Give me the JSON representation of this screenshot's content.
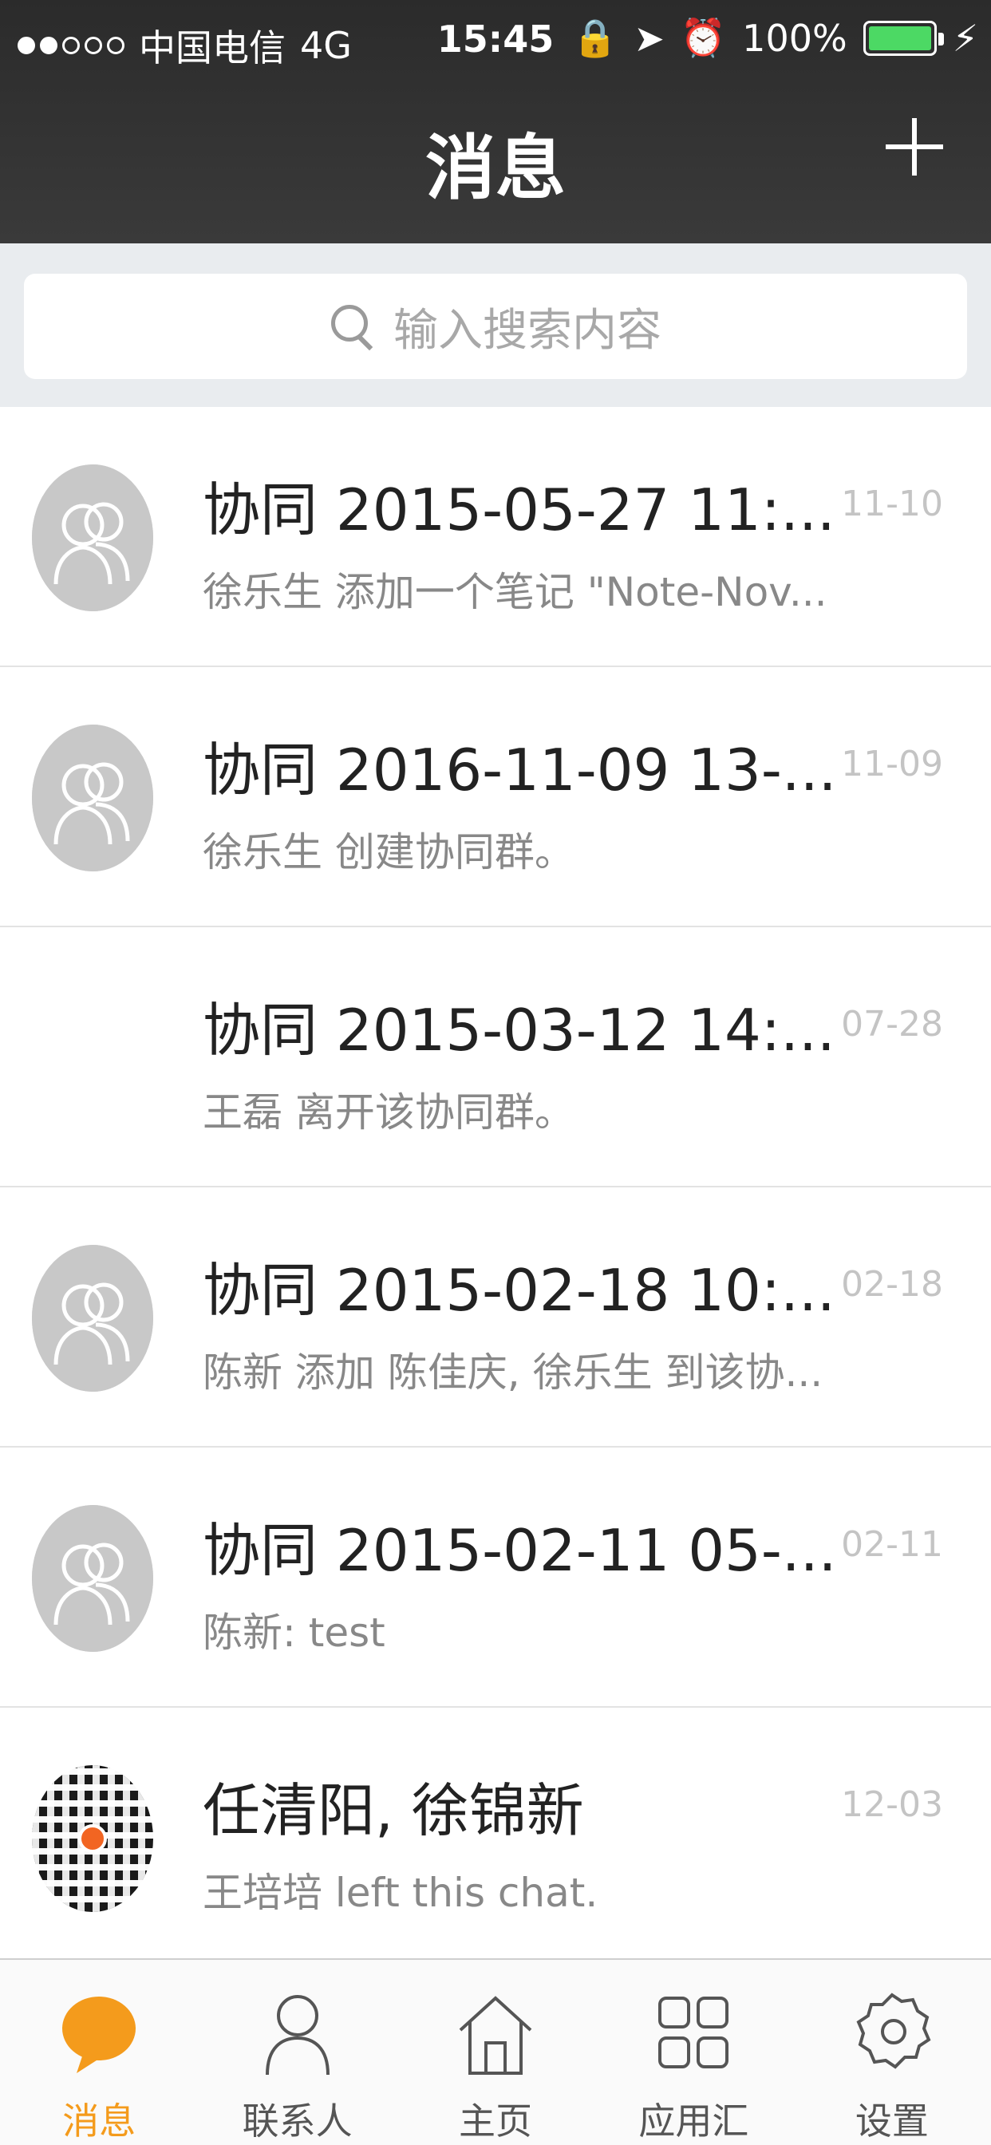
{
  "status_bar": {
    "carrier": "中国电信",
    "network": "4G",
    "time": "15:45",
    "battery": "100%",
    "colors": {
      "battery_fill": "#4cd964"
    }
  },
  "nav": {
    "title": "消息",
    "add_icon": "plus-icon"
  },
  "search": {
    "placeholder": "输入搜索内容",
    "icon": "search-icon"
  },
  "conversations": [
    {
      "title": "协同 2015-05-27 11:...",
      "preview": "徐乐生 添加一个笔记 \"Note-Nov...",
      "date": "11-10",
      "avatar": "group-avatar-icon"
    },
    {
      "title": "协同 2016-11-09 13-...",
      "preview": "徐乐生 创建协同群。",
      "date": "11-09",
      "avatar": "group-avatar-icon"
    },
    {
      "title": "协同 2015-03-12 14:...",
      "preview": "王磊 离开该协同群。",
      "date": "07-28",
      "avatar": "none"
    },
    {
      "title": "协同 2015-02-18 10:...",
      "preview": "陈新 添加 陈佳庆, 徐乐生 到该协...",
      "date": "02-18",
      "avatar": "group-avatar-icon"
    },
    {
      "title": "协同 2015-02-11 05-...",
      "preview": "陈新: test",
      "date": "02-11",
      "avatar": "group-avatar-icon"
    },
    {
      "title": "任清阳, 徐锦新",
      "preview": "王培培 left this chat.",
      "date": "12-03",
      "avatar": "qr-code-avatar"
    }
  ],
  "tabs": [
    {
      "label": "消息",
      "icon": "chat-bubble-icon",
      "active": true
    },
    {
      "label": "联系人",
      "icon": "person-icon",
      "active": false
    },
    {
      "label": "主页",
      "icon": "home-icon",
      "active": false
    },
    {
      "label": "应用汇",
      "icon": "apps-grid-icon",
      "active": false
    },
    {
      "label": "设置",
      "icon": "gear-icon",
      "active": false
    }
  ],
  "colors": {
    "nav_bg": "#333333",
    "accent": "#f49b1c",
    "search_bg": "#e9ecef"
  }
}
